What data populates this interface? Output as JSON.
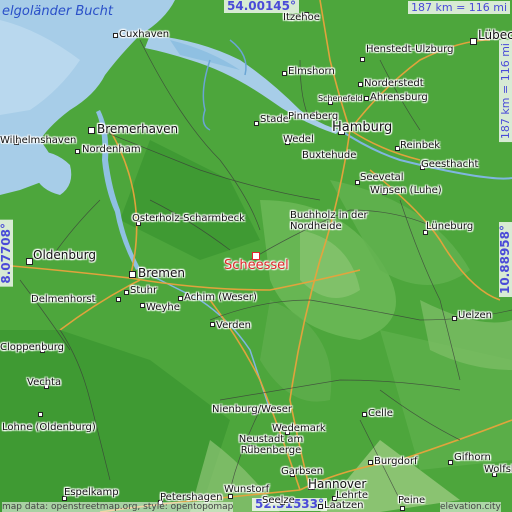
{
  "map": {
    "highlight": {
      "name": "Scheessel",
      "color": "#e0262a"
    },
    "sea_label": "elgoländer Bucht",
    "coords": {
      "top": "54.00145°",
      "bottom": "52.31533°",
      "left": "8.07708°",
      "right": "10.88958°",
      "scale_top": "187 km = 116 mi",
      "scale_right": "187 km = 116 mi"
    },
    "attribution_left": "map data: openstreetmap.org, style: opentopomap",
    "attribution_right": "elevation.city",
    "cities": [
      {
        "name": "Cuxhaven"
      },
      {
        "name": "Itzehoe"
      },
      {
        "name": "Lübeck"
      },
      {
        "name": "Henstedt-Ulzburg"
      },
      {
        "name": "Elmshorn"
      },
      {
        "name": "Norderstedt"
      },
      {
        "name": "Ahrensburg"
      },
      {
        "name": "Wilhelmshaven"
      },
      {
        "name": "Bremerhaven"
      },
      {
        "name": "Nordenham"
      },
      {
        "name": "Stade"
      },
      {
        "name": "Pinneberg"
      },
      {
        "name": "Hamburg"
      },
      {
        "name": "Wedel"
      },
      {
        "name": "Buxtehude"
      },
      {
        "name": "Reinbek"
      },
      {
        "name": "Geesthacht"
      },
      {
        "name": "Seevetal"
      },
      {
        "name": "Winsen (Luhe)"
      },
      {
        "name": "Osterholz-Scharmbeck"
      },
      {
        "name": "Buchholz in der Nordheide"
      },
      {
        "name": "Lüneburg"
      },
      {
        "name": "Oldenburg"
      },
      {
        "name": "Bremen"
      },
      {
        "name": "Stuhr"
      },
      {
        "name": "Delmenhorst"
      },
      {
        "name": "Weyhe"
      },
      {
        "name": "Achim (Weser)"
      },
      {
        "name": "Verden"
      },
      {
        "name": "Uelzen"
      },
      {
        "name": "Cloppenburg"
      },
      {
        "name": "Vechta"
      },
      {
        "name": "Lohne (Oldenburg)"
      },
      {
        "name": "Nienburg/Weser"
      },
      {
        "name": "Celle"
      },
      {
        "name": "Wedemark"
      },
      {
        "name": "Neustadt am Rübenberge"
      },
      {
        "name": "Burgdorf"
      },
      {
        "name": "Gifhorn"
      },
      {
        "name": "Garbsen"
      },
      {
        "name": "Hannover"
      },
      {
        "name": "Lehrte"
      },
      {
        "name": "Seelze"
      },
      {
        "name": "Laatzen"
      },
      {
        "name": "Espelkamp"
      },
      {
        "name": "Petershagen"
      },
      {
        "name": "Wunstorf"
      },
      {
        "name": "Peine"
      },
      {
        "name": "Wolfsburg"
      },
      {
        "name": "Schenefeld"
      }
    ]
  }
}
